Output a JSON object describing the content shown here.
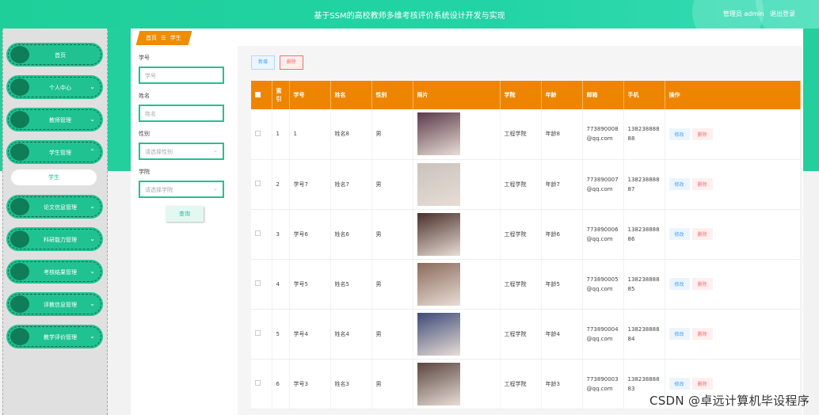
{
  "header": {
    "title": "基于SSM的高校教师多维考核评价系统设计开发与实现",
    "role": "管理员 admin",
    "logout": "退出登录"
  },
  "sidebar": {
    "items": [
      {
        "label": "首页",
        "chev": ""
      },
      {
        "label": "个人中心",
        "chev": "⌄"
      },
      {
        "label": "教师管理",
        "chev": "⌄"
      },
      {
        "label": "学生管理",
        "chev": "⌃"
      },
      {
        "label": "论文信息管理",
        "chev": "⌄"
      },
      {
        "label": "科研能力管理",
        "chev": "⌄"
      },
      {
        "label": "考核结果管理",
        "chev": "⌄"
      },
      {
        "label": "评教信息管理",
        "chev": "⌄"
      },
      {
        "label": "教学评价管理",
        "chev": "⌄"
      }
    ],
    "sub_item": "学生"
  },
  "breadcrumb": {
    "home": "首页",
    "sep": "☰",
    "current": "学生"
  },
  "search": {
    "student_no_label": "学号",
    "student_no_placeholder": "学号",
    "name_label": "姓名",
    "name_placeholder": "姓名",
    "gender_label": "性别",
    "gender_placeholder": "请选择性别",
    "college_label": "学院",
    "college_placeholder": "请选择学院",
    "query_button": "查询"
  },
  "toolbar": {
    "add": "新增",
    "delete": "删除"
  },
  "table": {
    "headers": [
      "索引",
      "学号",
      "姓名",
      "性别",
      "照片",
      "学院",
      "年龄",
      "邮箱",
      "手机",
      "操作"
    ],
    "edit_label": "修改",
    "delete_label": "删除",
    "rows": [
      {
        "index": "1",
        "no": "1",
        "name": "姓名8",
        "gender": "男",
        "college": "工程学院",
        "age": "年龄8",
        "email_1": "773890008",
        "email_2": "@qq.com",
        "phone_1": "138238888",
        "phone_2": "88",
        "photo_color": "#5a3a4a"
      },
      {
        "index": "2",
        "no": "学号7",
        "name": "姓名7",
        "gender": "男",
        "college": "工程学院",
        "age": "年龄7",
        "email_1": "773890007",
        "email_2": "@qq.com",
        "phone_1": "138238888",
        "phone_2": "87",
        "photo_color": "#c9c2bd"
      },
      {
        "index": "3",
        "no": "学号6",
        "name": "姓名6",
        "gender": "男",
        "college": "工程学院",
        "age": "年龄6",
        "email_1": "773890006",
        "email_2": "@qq.com",
        "phone_1": "138238888",
        "phone_2": "86",
        "photo_color": "#4a2f2a"
      },
      {
        "index": "4",
        "no": "学号5",
        "name": "姓名5",
        "gender": "男",
        "college": "工程学院",
        "age": "年龄5",
        "email_1": "773890005",
        "email_2": "@qq.com",
        "phone_1": "138238888",
        "phone_2": "85",
        "photo_color": "#8a6b5a"
      },
      {
        "index": "5",
        "no": "学号4",
        "name": "姓名4",
        "gender": "男",
        "college": "工程学院",
        "age": "年龄4",
        "email_1": "773890004",
        "email_2": "@qq.com",
        "phone_1": "138238888",
        "phone_2": "84",
        "photo_color": "#3d4a78"
      },
      {
        "index": "6",
        "no": "学号3",
        "name": "姓名3",
        "gender": "男",
        "college": "工程学院",
        "age": "年龄3",
        "email_1": "773890003",
        "email_2": "@qq.com",
        "phone_1": "138238888",
        "phone_2": "83",
        "photo_color": "#5a4540"
      }
    ]
  },
  "watermark": "CSDN @卓远计算机毕设程序"
}
